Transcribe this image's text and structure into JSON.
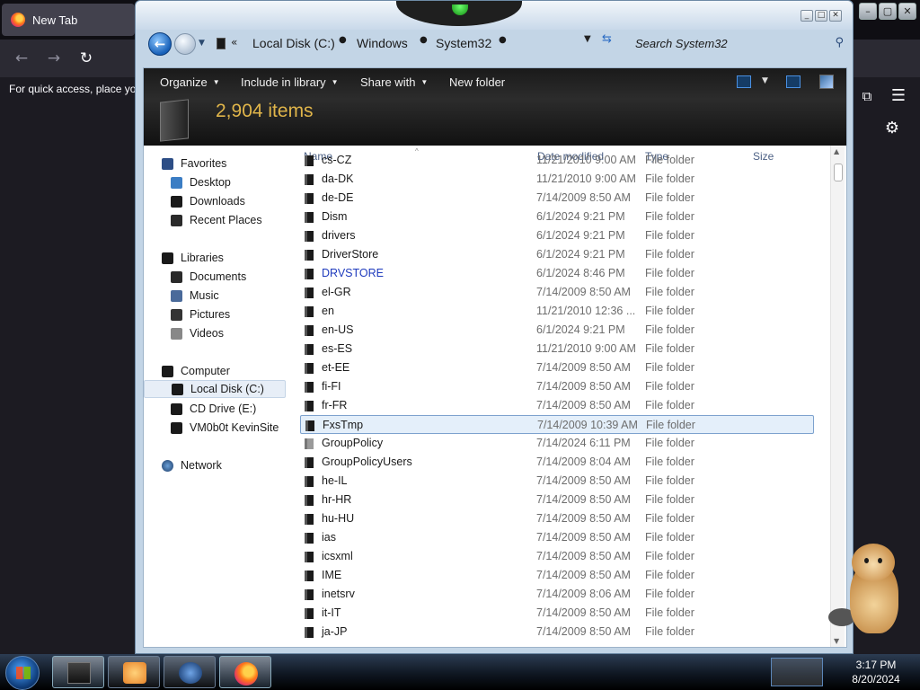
{
  "browser": {
    "tab_title": "New Tab",
    "bookmarks_hint": "For quick access, place you"
  },
  "explorer": {
    "breadcrumbs": [
      "Local Disk (C:)",
      "Windows",
      "System32"
    ],
    "search_placeholder": "Search System32",
    "toolbar": {
      "organize": "Organize",
      "include_in_library": "Include in library",
      "share_with": "Share with",
      "new_folder": "New folder"
    },
    "item_count": "2,904 items",
    "nav": {
      "favorites": "Favorites",
      "favorites_items": [
        "Desktop",
        "Downloads",
        "Recent Places"
      ],
      "libraries": "Libraries",
      "libraries_items": [
        "Documents",
        "Music",
        "Pictures",
        "Videos"
      ],
      "computer": "Computer",
      "computer_items": [
        "Local Disk (C:)",
        "CD Drive (E:)",
        "VM0b0t KevinSite"
      ],
      "network": "Network"
    },
    "columns": {
      "name": "Name",
      "date": "Date modified",
      "type": "Type",
      "size": "Size"
    },
    "rows": [
      {
        "name": "cs-CZ",
        "date": "11/21/2010 9:00 AM",
        "type": "File folder"
      },
      {
        "name": "da-DK",
        "date": "11/21/2010 9:00 AM",
        "type": "File folder"
      },
      {
        "name": "de-DE",
        "date": "7/14/2009 8:50 AM",
        "type": "File folder"
      },
      {
        "name": "Dism",
        "date": "6/1/2024 9:21 PM",
        "type": "File folder"
      },
      {
        "name": "drivers",
        "date": "6/1/2024 9:21 PM",
        "type": "File folder"
      },
      {
        "name": "DriverStore",
        "date": "6/1/2024 9:21 PM",
        "type": "File folder"
      },
      {
        "name": "DRVSTORE",
        "date": "6/1/2024 8:46 PM",
        "type": "File folder"
      },
      {
        "name": "el-GR",
        "date": "7/14/2009 8:50 AM",
        "type": "File folder"
      },
      {
        "name": "en",
        "date": "11/21/2010 12:36 ...",
        "type": "File folder"
      },
      {
        "name": "en-US",
        "date": "6/1/2024 9:21 PM",
        "type": "File folder"
      },
      {
        "name": "es-ES",
        "date": "11/21/2010 9:00 AM",
        "type": "File folder"
      },
      {
        "name": "et-EE",
        "date": "7/14/2009 8:50 AM",
        "type": "File folder"
      },
      {
        "name": "fi-FI",
        "date": "7/14/2009 8:50 AM",
        "type": "File folder"
      },
      {
        "name": "fr-FR",
        "date": "7/14/2009 8:50 AM",
        "type": "File folder"
      },
      {
        "name": "FxsTmp",
        "date": "7/14/2009 10:39 AM",
        "type": "File folder"
      },
      {
        "name": "GroupPolicy",
        "date": "7/14/2024 6:11 PM",
        "type": "File folder"
      },
      {
        "name": "GroupPolicyUsers",
        "date": "7/14/2009 8:04 AM",
        "type": "File folder"
      },
      {
        "name": "he-IL",
        "date": "7/14/2009 8:50 AM",
        "type": "File folder"
      },
      {
        "name": "hr-HR",
        "date": "7/14/2009 8:50 AM",
        "type": "File folder"
      },
      {
        "name": "hu-HU",
        "date": "7/14/2009 8:50 AM",
        "type": "File folder"
      },
      {
        "name": "ias",
        "date": "7/14/2009 8:50 AM",
        "type": "File folder"
      },
      {
        "name": "icsxml",
        "date": "7/14/2009 8:50 AM",
        "type": "File folder"
      },
      {
        "name": "IME",
        "date": "7/14/2009 8:50 AM",
        "type": "File folder"
      },
      {
        "name": "inetsrv",
        "date": "7/14/2009 8:06 AM",
        "type": "File folder"
      },
      {
        "name": "it-IT",
        "date": "7/14/2009 8:50 AM",
        "type": "File folder"
      },
      {
        "name": "ja-JP",
        "date": "7/14/2009 8:50 AM",
        "type": "File folder"
      }
    ],
    "selected_row": "FxsTmp",
    "highlighted_row": "DRVSTORE",
    "greyed_row": "GroupPolicy"
  },
  "taskbar": {
    "time": "3:17 PM",
    "date": "8/20/2024"
  },
  "colors": {
    "toolbar_bg": "#1a1a1a",
    "item_count": "#e0b54a",
    "selection": "#e4effa",
    "link_blue": "#1f3bbd"
  }
}
